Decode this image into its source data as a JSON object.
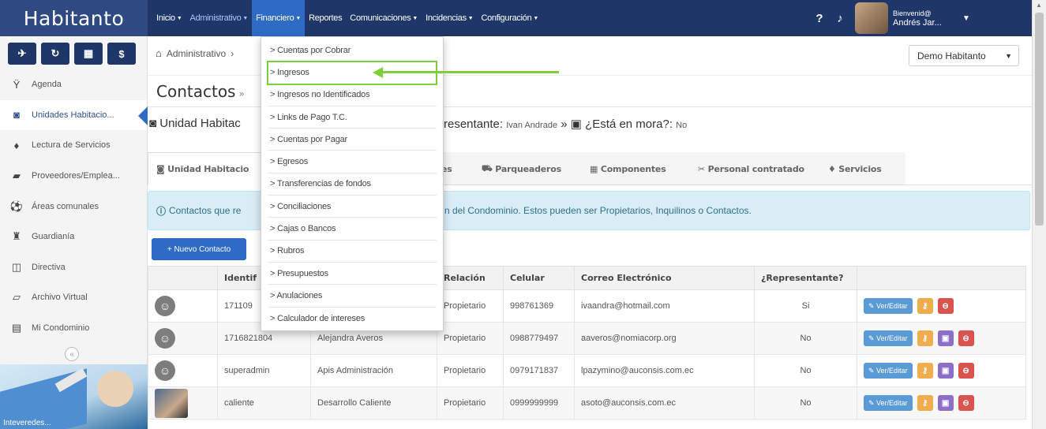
{
  "brand": "Habitanto",
  "nav": {
    "items": [
      {
        "label": "Inicio",
        "caret": true
      },
      {
        "label": "Administrativo",
        "caret": true
      },
      {
        "label": "Financiero",
        "caret": true
      },
      {
        "label": "Reportes",
        "caret": false
      },
      {
        "label": "Comunicaciones",
        "caret": true
      },
      {
        "label": "Incidencias",
        "caret": true
      },
      {
        "label": "Configuración",
        "caret": true
      }
    ],
    "help_icon": "question-circle-icon",
    "bell_icon": "bell-icon",
    "user": {
      "greeting": "Bienvenid@",
      "name": "Andrés Jar..."
    }
  },
  "sidebar": {
    "tools": [
      {
        "icon": "send-icon",
        "glyph": "✈"
      },
      {
        "icon": "refresh-icon",
        "glyph": "↻"
      },
      {
        "icon": "calculator-icon",
        "glyph": "▦"
      },
      {
        "icon": "dollar-icon",
        "glyph": "$"
      }
    ],
    "items": [
      {
        "label": "Agenda",
        "icon": "agenda-icon",
        "glyph": "Ϋ"
      },
      {
        "label": "Unidades Habitacio...",
        "icon": "unit-icon",
        "glyph": "◙",
        "active": true
      },
      {
        "label": "Lectura de Servicios",
        "icon": "drop-icon",
        "glyph": "♦"
      },
      {
        "label": "Proveedores/Emplea...",
        "icon": "truck-icon",
        "glyph": "▰"
      },
      {
        "label": "Áreas comunales",
        "icon": "ball-icon",
        "glyph": "⚽"
      },
      {
        "label": "Guardianía",
        "icon": "guard-icon",
        "glyph": "♜"
      },
      {
        "label": "Directiva",
        "icon": "board-icon",
        "glyph": "◫"
      },
      {
        "label": "Archivo Virtual",
        "icon": "archive-icon",
        "glyph": "▱"
      },
      {
        "label": "Mi Condominio",
        "icon": "building-icon",
        "glyph": "▤"
      }
    ],
    "collapse_glyph": "«",
    "promo_text": "Inteveredes..."
  },
  "breadcrumb": {
    "home_glyph": "⌂",
    "item": "Administrativo",
    "sep": "›"
  },
  "condo_select": "Demo Habitanto",
  "title": "Contactos",
  "title_sep": "»",
  "unit_line": {
    "left": "Unidad Habitac",
    "right_label": "resentante:",
    "rep_name": "Ivan Andrade",
    "mora_label": "¿Está en mora?:",
    "mora_value": "No"
  },
  "tabs": [
    "Unidad Habitacio",
    "es",
    "Parqueaderos",
    "Componentes",
    "Personal contratado",
    "Servicios"
  ],
  "info_text": {
    "part1": "Contactos que re",
    "part2": "n del Condominio. Estos pueden ser Propietarios, Inquilinos o Contactos."
  },
  "new_contact_button": "Nuevo Contacto",
  "table": {
    "headers": [
      "",
      "Identif",
      "",
      "Relación",
      "Celular",
      "Correo Electrónico",
      "¿Representante?",
      ""
    ],
    "rows": [
      {
        "id": "171109",
        "name": "",
        "relation": "Propietario",
        "phone": "998761369",
        "email": "ivaandra@hotmail.com",
        "rep": "Si",
        "photo": false,
        "purple": false
      },
      {
        "id": "1716821804",
        "name": "Alejandra Averos",
        "relation": "Propietario",
        "phone": "0988779497",
        "email": "aaveros@nomiacorp.org",
        "rep": "No",
        "photo": false,
        "purple": true
      },
      {
        "id": "superadmin",
        "name": "Apis Administración",
        "relation": "Propietario",
        "phone": "0979171837",
        "email": "lpazymino@auconsis.com.ec",
        "rep": "No",
        "photo": false,
        "purple": true
      },
      {
        "id": "caliente",
        "name": "Desarrollo Caliente",
        "relation": "Propietario",
        "phone": "0999999999",
        "email": "asoto@auconsis.com.ec",
        "rep": "No",
        "photo": true,
        "purple": true
      }
    ],
    "edit_label": "Ver/Editar"
  },
  "dropdown": {
    "items": [
      "> Cuentas por Cobrar",
      "> Ingresos",
      "> Ingresos no Identificados",
      "> Links de Pago T.C.",
      "> Cuentas por Pagar",
      "> Egresos",
      "> Transferencias de fondos",
      "> Conciliaciones",
      "> Cajas o Bancos",
      "> Rubros",
      "> Presupuestos",
      "> Anulaciones",
      "> Calculador de intereses"
    ],
    "highlighted_index": 1
  },
  "colors": {
    "navbar": "#1e3668",
    "accent": "#2d6bc4",
    "highlight": "#7ed03a"
  }
}
